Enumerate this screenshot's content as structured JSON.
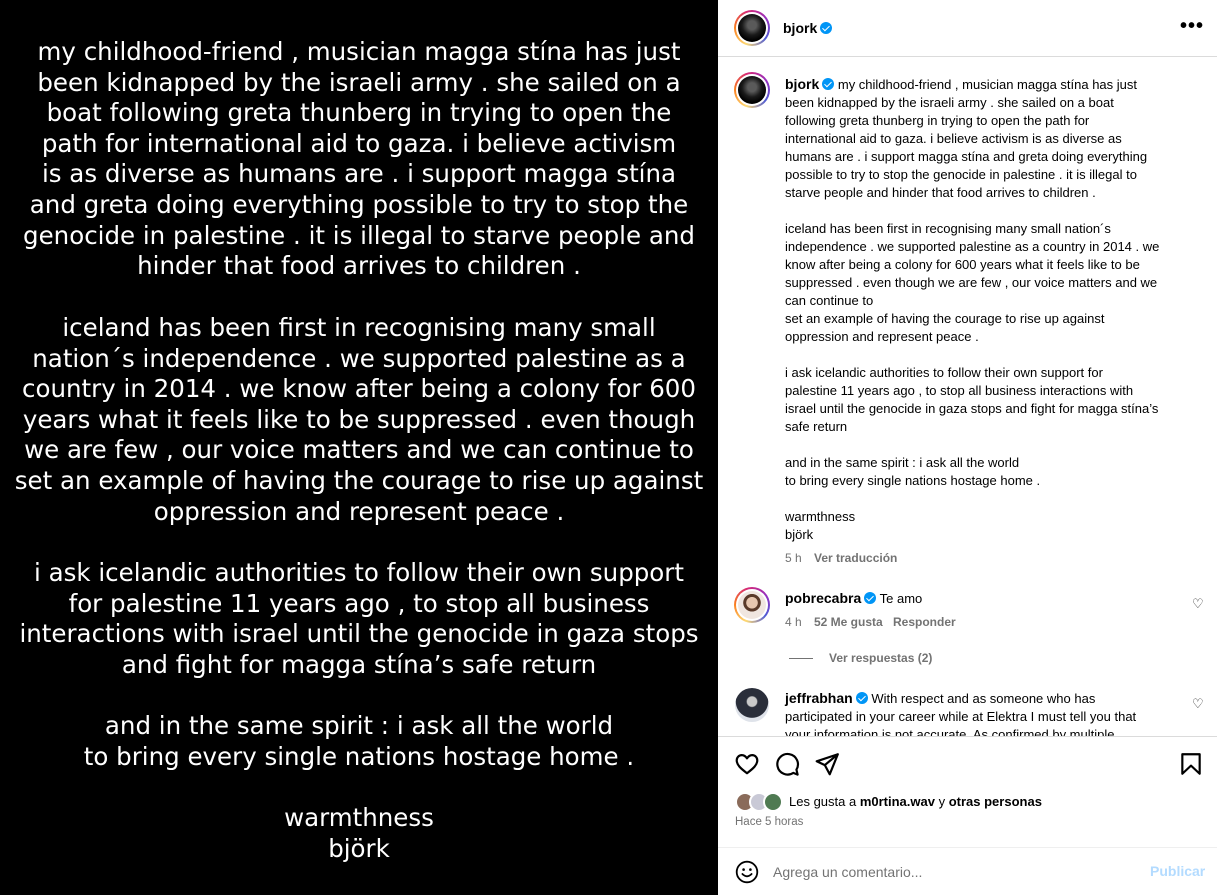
{
  "image": {
    "paragraphs": [
      "my childhood-friend , musician magga stína has just\nbeen kidnapped by the israeli army . she sailed on a\nboat following greta thunberg in trying to open the\npath for international aid to gaza. i believe activism\nis as diverse as humans are . i support magga stína\nand greta doing everything possible to try to stop the\ngenocide in palestine . it is illegal to starve people and\nhinder that food arrives to children .",
      "iceland has been first in recognising many small\nnation´s independence . we supported palestine as a\ncountry in 2014 . we know after being a colony for 600\nyears what it feels like to be suppressed . even though\nwe are few , our voice matters and we can continue to\nset an example of having the courage to rise up against\noppression and represent peace .",
      "i ask icelandic authorities to follow their own support\nfor palestine 11 years ago , to stop all business\ninteractions with israel until the genocide in gaza stops\nand fight for magga stína’s safe return",
      "and in the same spirit : i ask all the world\nto bring every single nations hostage home .",
      "warmthness\nbjörk"
    ]
  },
  "header": {
    "username": "bjork",
    "more_label": "•••"
  },
  "caption": {
    "username": "bjork",
    "text": "my childhood-friend , musician magga stína has just\nbeen kidnapped by the israeli army . she sailed on a boat\nfollowing greta thunberg in trying to open the path for\ninternational aid to gaza. i believe activism is as diverse as\nhumans are . i support magga stína and greta doing everything\npossible to try to stop the genocide in palestine . it is illegal to\nstarve people and hinder that food arrives to children .\n\niceland has been first in recognising many small nation´s\nindependence . we supported palestine as a country in 2014 . we\nknow after being a colony for 600 years what it feels like to be\nsuppressed . even though we are few , our voice matters and we\ncan continue to\nset an example of having the courage to rise up against\noppression and represent peace .\n\ni ask icelandic authorities to follow their own support for\npalestine 11 years ago , to stop all business interactions with\nisrael until the genocide in gaza stops and fight for magga stína’s\nsafe return\n\nand in the same spirit : i ask all the world\nto bring every single nations hostage home .\n\nwarmthness\nbjörk",
    "time": "5 h",
    "translate": "Ver traducción"
  },
  "comments": [
    {
      "username": "pobrecabra",
      "text": "Te amo",
      "time": "4 h",
      "likes": "52 Me gusta",
      "reply": "Responder",
      "view_replies": "Ver respuestas (2)"
    },
    {
      "username": "jeffrabhan",
      "text": "With respect and as someone who has\nparticipated in your career while at Elektra I must tell you that\nyour information is not accurate. As confirmed by multiple"
    }
  ],
  "likes": {
    "prefix": "Les gusta a ",
    "user": "m0rtina.wav",
    "middle": " y ",
    "suffix": "otras personas"
  },
  "posted": "Hace 5 horas",
  "comment_box": {
    "placeholder": "Agrega un comentario...",
    "publish": "Publicar"
  },
  "icons": {
    "heart": "heart-icon",
    "comment": "comment-icon",
    "share": "share-icon",
    "save": "bookmark-icon",
    "emoji": "emoji-icon"
  },
  "colors": {
    "verified": "#0095f6",
    "publish_disabled": "#b3dbff",
    "muted": "#737373"
  }
}
